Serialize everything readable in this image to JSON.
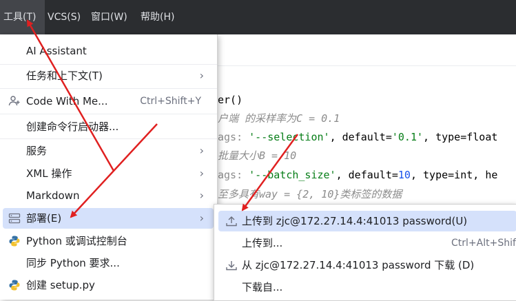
{
  "menubar": {
    "items": [
      {
        "label": "工具(T)"
      },
      {
        "label": "VCS(S)"
      },
      {
        "label": "窗口(W)"
      },
      {
        "label": "帮助(H)"
      }
    ]
  },
  "editor": {
    "lines": [
      "er()",
      "户端 的采样率为C = 0.1",
      "ags: ",
      "'--selection'",
      ", default=",
      "'0.1'",
      ", type=float",
      "批量大小B = 10",
      "'--batch_size'",
      "10",
      ", type=int, he",
      "至多具有way = {2, 10}类标签的数据"
    ]
  },
  "tools_menu": {
    "items": [
      {
        "label": "AI Assistant"
      },
      {
        "label": "任务和上下文(T)"
      },
      {
        "label": "Code With Me...",
        "shortcut": "Ctrl+Shift+Y"
      },
      {
        "label": "创建命令行启动器..."
      },
      {
        "label": "服务"
      },
      {
        "label": "XML 操作"
      },
      {
        "label": "Markdown"
      },
      {
        "label": "部署(E)"
      },
      {
        "label": "Python 或调试控制台"
      },
      {
        "label": "同步 Python 要求..."
      },
      {
        "label": "创建 setup.py"
      }
    ]
  },
  "deployment_submenu": {
    "items": [
      {
        "label": "上传到 zjc@172.27.14.4:41013 password(U)"
      },
      {
        "label": "上传到...",
        "shortcut": "Ctrl+Alt+Shift"
      },
      {
        "label": "从 zjc@172.27.14.4:41013 password 下载 (D)"
      },
      {
        "label": "下载自..."
      }
    ]
  },
  "colors": {
    "menubar_bg": "#2b2d30",
    "selection": "#d5e1fb",
    "annotation_arrow": "#e02020"
  }
}
